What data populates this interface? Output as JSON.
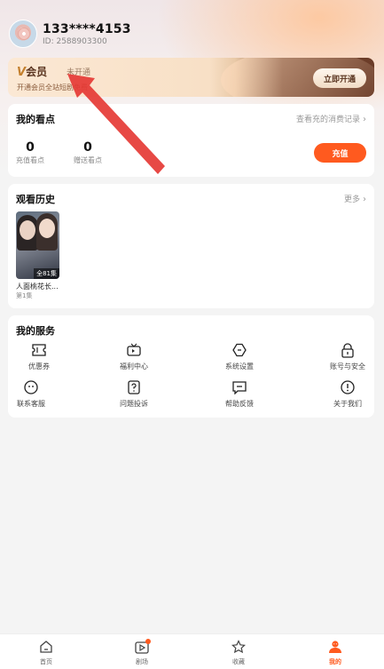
{
  "profile": {
    "phone": "133****4153",
    "uid": "ID: 2588903300"
  },
  "vip": {
    "logo_mark": "V",
    "title": "会员",
    "status": "未开通",
    "desc": "开通会员全站短剧免费",
    "button": "立即开通"
  },
  "points": {
    "title": "我的看点",
    "link": "查看充的消费记录",
    "recharged_value": "0",
    "recharged_label": "充值看点",
    "gifted_value": "0",
    "gifted_label": "赠送看点",
    "recharge_button": "充值"
  },
  "history": {
    "title": "观看历史",
    "more": "更多",
    "items": [
      {
        "title": "人面桃花长...",
        "episode": "第1集",
        "badge": "全81集"
      }
    ]
  },
  "services": {
    "title": "我的服务",
    "items": [
      {
        "label": "优惠券",
        "icon": "coupon-icon"
      },
      {
        "label": "福利中心",
        "icon": "tv-gift-icon"
      },
      {
        "label": "系统设置",
        "icon": "settings-icon"
      },
      {
        "label": "账号与安全",
        "icon": "lock-icon"
      },
      {
        "label": "联系客服",
        "icon": "service-face-icon"
      },
      {
        "label": "问题投诉",
        "icon": "question-icon"
      },
      {
        "label": "帮助反馈",
        "icon": "feedback-icon"
      },
      {
        "label": "关于我们",
        "icon": "info-icon"
      }
    ]
  },
  "tabbar": {
    "items": [
      {
        "label": "首页",
        "icon": "home-icon"
      },
      {
        "label": "剧场",
        "icon": "theater-icon"
      },
      {
        "label": "收藏",
        "icon": "star-icon"
      },
      {
        "label": "我的",
        "icon": "profile-icon"
      }
    ],
    "active": "我的"
  },
  "colors": {
    "accent": "#ff5a1f",
    "annotation_arrow": "#e53935",
    "vip_dark": "#6b3c28"
  }
}
